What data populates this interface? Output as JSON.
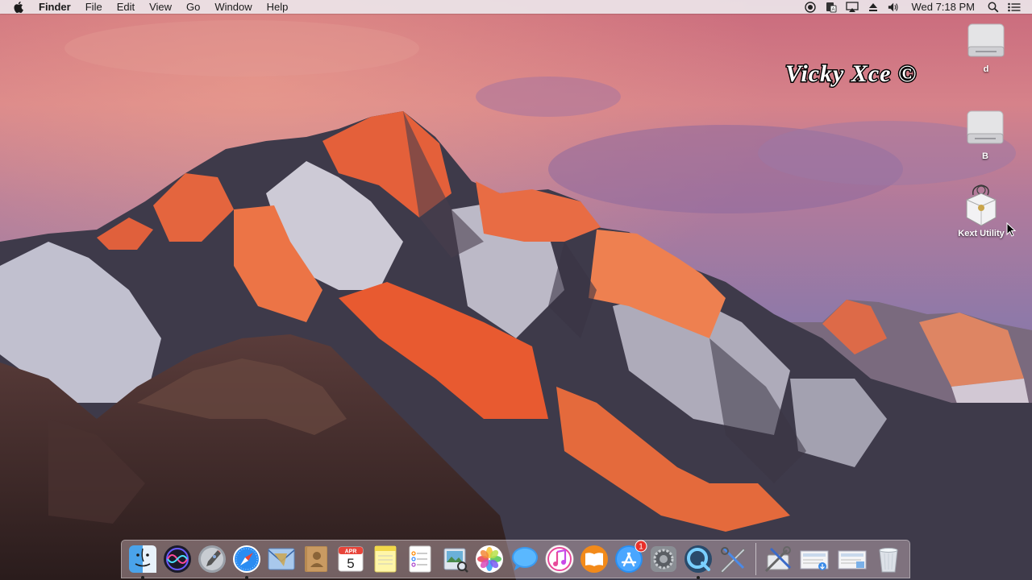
{
  "menubar": {
    "app_name": "Finder",
    "menus": [
      "File",
      "Edit",
      "View",
      "Go",
      "Window",
      "Help"
    ],
    "clock": "Wed 7:18 PM",
    "status_icons": [
      "record-icon",
      "input-menu-icon",
      "airplay-icon",
      "eject-icon",
      "volume-icon"
    ]
  },
  "desktop": {
    "icons": [
      {
        "label": "d",
        "icon": "hard-drive-icon"
      },
      {
        "label": "B",
        "icon": "hard-drive-icon"
      },
      {
        "label": "Kext Utility",
        "icon": "kext-utility-icon"
      }
    ]
  },
  "watermark": {
    "text": "Vicky Xce ©"
  },
  "dock": {
    "apps": [
      {
        "name": "Finder",
        "icon": "finder-icon",
        "running": true
      },
      {
        "name": "Siri",
        "icon": "siri-icon",
        "running": false
      },
      {
        "name": "Launchpad",
        "icon": "launchpad-icon",
        "running": false
      },
      {
        "name": "Safari",
        "icon": "safari-icon",
        "running": true
      },
      {
        "name": "Mail",
        "icon": "mail-icon",
        "running": false
      },
      {
        "name": "Contacts",
        "icon": "contacts-icon",
        "running": false
      },
      {
        "name": "Calendar",
        "icon": "calendar-icon",
        "running": false,
        "month": "APR",
        "day": "5"
      },
      {
        "name": "Notes",
        "icon": "notes-icon",
        "running": false
      },
      {
        "name": "Reminders",
        "icon": "reminders-icon",
        "running": false
      },
      {
        "name": "Preview",
        "icon": "preview-icon",
        "running": false
      },
      {
        "name": "Photos",
        "icon": "photos-icon",
        "running": false
      },
      {
        "name": "Messages",
        "icon": "messages-icon",
        "running": false
      },
      {
        "name": "iTunes",
        "icon": "itunes-icon",
        "running": false
      },
      {
        "name": "iBooks",
        "icon": "ibooks-icon",
        "running": false
      },
      {
        "name": "App Store",
        "icon": "app-store-icon",
        "running": false,
        "badge": "1"
      },
      {
        "name": "System Preferences",
        "icon": "system-preferences-icon",
        "running": false
      },
      {
        "name": "QuickTime Player",
        "icon": "quicktime-icon",
        "running": true
      },
      {
        "name": "Utilities",
        "icon": "utilities-icon",
        "running": false
      }
    ],
    "right_items": [
      {
        "name": "Kext Utility",
        "icon": "kext-tools-icon"
      },
      {
        "name": "Downloads",
        "icon": "downloads-stack-icon"
      },
      {
        "name": "Documents",
        "icon": "documents-stack-icon"
      },
      {
        "name": "Trash",
        "icon": "trash-icon"
      }
    ]
  }
}
